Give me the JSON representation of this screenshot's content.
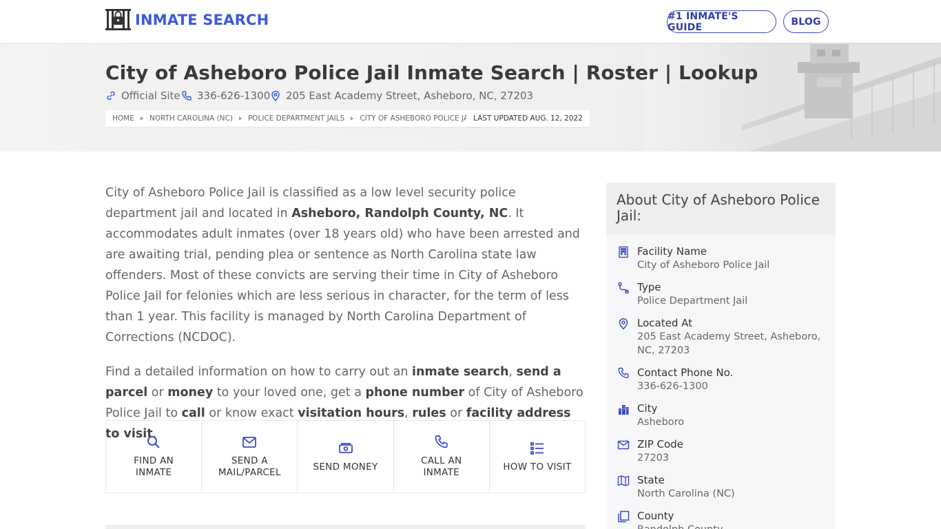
{
  "header": {
    "logo_text": "INMATE SEARCH",
    "logo_icon": "jail-lock-icon",
    "nav": [
      {
        "label": "#1 INMATE'S GUIDE"
      },
      {
        "label": "BLOG"
      }
    ],
    "accent_color": "#3b5bdb"
  },
  "hero": {
    "title": "City of Asheboro Police Jail Inmate Search | Roster | Lookup",
    "official_site": "Official Site",
    "phone": "336-626-1300",
    "address": "205 East Academy Street, Asheboro, NC, 27203",
    "breadcrumbs": [
      "HOME",
      "NORTH CAROLINA (NC)",
      "POLICE DEPARTMENT JAILS",
      "CITY OF ASHEBORO POLICE JAIL"
    ],
    "last_updated": "LAST UPDATED AUG. 12, 2022"
  },
  "content": {
    "p1": {
      "a": "City of Asheboro Police Jail is classified as a low level security police department jail and located in ",
      "b": "Asheboro, Randolph County, NC",
      "c": ". It accommodates adult inmates (over 18 years old) who have been arrested and are awaiting trial, pending plea or sentence as North Carolina state law offenders. Most of these convicts are serving their time in City of Asheboro Police Jail for felonies which are less serious in character, for the term of less than 1 year. This facility is managed by North Carolina Department of Corrections (NCDOC)."
    },
    "p2": {
      "t1": "Find a detailed information on how to carry out an ",
      "b1": "inmate search",
      "t2": ", ",
      "b2": "send a parcel",
      "t3": " or ",
      "b3": "money",
      "t4": " to your loved one, get a ",
      "b4": "phone number",
      "t5": " of City of Asheboro Police Jail to ",
      "b5": "call",
      "t6": " or know exact ",
      "b6": "visitation hours",
      "t7": ", ",
      "b7": "rules",
      "t8": " or ",
      "b8": "facility address to visit",
      "t9": "."
    },
    "actions": [
      {
        "line1": "FIND AN",
        "line2": "INMATE",
        "icon": "search-icon"
      },
      {
        "line1": "SEND A",
        "line2": "MAIL/PARCEL",
        "icon": "mail-icon"
      },
      {
        "line1": "SEND MONEY",
        "line2": "",
        "icon": "money-icon"
      },
      {
        "line1": "CALL AN",
        "line2": "INMATE",
        "icon": "phone-icon"
      },
      {
        "line1": "HOW TO VISIT",
        "line2": "",
        "icon": "list-icon"
      }
    ]
  },
  "sidebar": {
    "title": "About City of Asheboro Police Jail:",
    "items": [
      {
        "label": "Facility Name",
        "value": "City of Asheboro Police Jail",
        "icon": "building-icon"
      },
      {
        "label": "Type",
        "value": "Police Department Jail",
        "icon": "route-icon"
      },
      {
        "label": "Located At",
        "value": "205 East Academy Street, Asheboro, NC, 27203",
        "icon": "map-pin-icon"
      },
      {
        "label": "Contact Phone No.",
        "value": "336-626-1300",
        "icon": "phone-icon"
      },
      {
        "label": "City",
        "value": "Asheboro",
        "icon": "city-icon"
      },
      {
        "label": "ZIP Code",
        "value": "27203",
        "icon": "envelope-icon"
      },
      {
        "label": "State",
        "value": "North Carolina (NC)",
        "icon": "map-icon"
      },
      {
        "label": "County",
        "value": "Randolph County",
        "icon": "copy-icon"
      }
    ]
  }
}
